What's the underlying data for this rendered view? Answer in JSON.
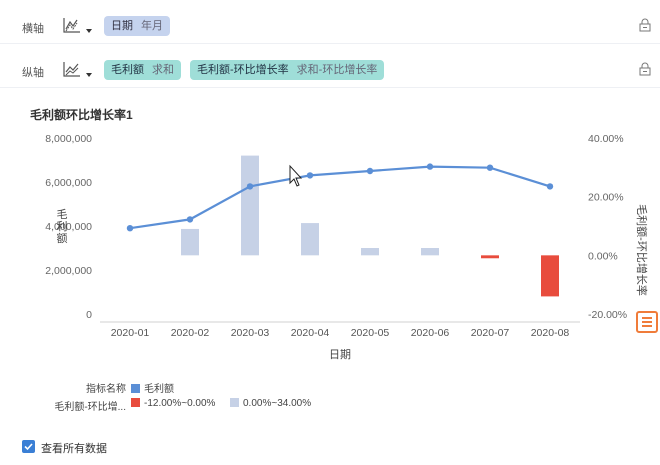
{
  "x_axis_row": {
    "label": "横轴",
    "fields": [
      {
        "name": "日期",
        "agg": "年月"
      }
    ]
  },
  "y_axis_row": {
    "label": "纵轴",
    "fields": [
      {
        "name": "毛利额",
        "agg": "求和"
      },
      {
        "name": "毛利额-环比增长率",
        "agg": "求和-环比增长率"
      }
    ]
  },
  "chart_data": {
    "type": "bar+line",
    "title": "毛利额环比增长率1",
    "xlabel": "日期",
    "ylabel_left": "毛利额",
    "ylabel_right": "毛利额-环比增长率",
    "categories": [
      "2020-01",
      "2020-02",
      "2020-03",
      "2020-04",
      "2020-05",
      "2020-06",
      "2020-07",
      "2020-08"
    ],
    "left_ticks": [
      "8,000,000",
      "6,000,000",
      "4,000,000",
      "2,000,000",
      "0"
    ],
    "right_ticks": [
      "40.00%",
      "20.00%",
      "0.00%",
      "-20.00%"
    ],
    "ylim_left": [
      0,
      8000000
    ],
    "ylim_right": [
      -20,
      40
    ],
    "series": [
      {
        "name": "毛利额",
        "type": "line",
        "values": [
          3900000,
          4300000,
          5800000,
          6300000,
          6500000,
          6700000,
          6650000,
          5800000
        ]
      },
      {
        "name": "毛利额-环比增长率",
        "type": "bar",
        "values": [
          null,
          9,
          34,
          11,
          2.5,
          2.5,
          -1,
          -14
        ]
      }
    ],
    "colors": {
      "line": "#5b8fd6",
      "bar_positive": "#c6d1e6",
      "bar_negative": "#e84c3d"
    },
    "grid": false
  },
  "legend": {
    "rows": [
      {
        "name": "指标名称",
        "items": [
          {
            "label": "毛利额",
            "color": "#5b8fd6"
          }
        ]
      },
      {
        "name": "毛利额-环比增...",
        "items": [
          {
            "label": "-12.00%~0.00%",
            "color": "#e84c3d"
          },
          {
            "label": "0.00%~34.00%",
            "color": "#c6d1e6"
          }
        ]
      }
    ]
  },
  "show_all_data": {
    "label": "查看所有数据",
    "checked": true
  }
}
